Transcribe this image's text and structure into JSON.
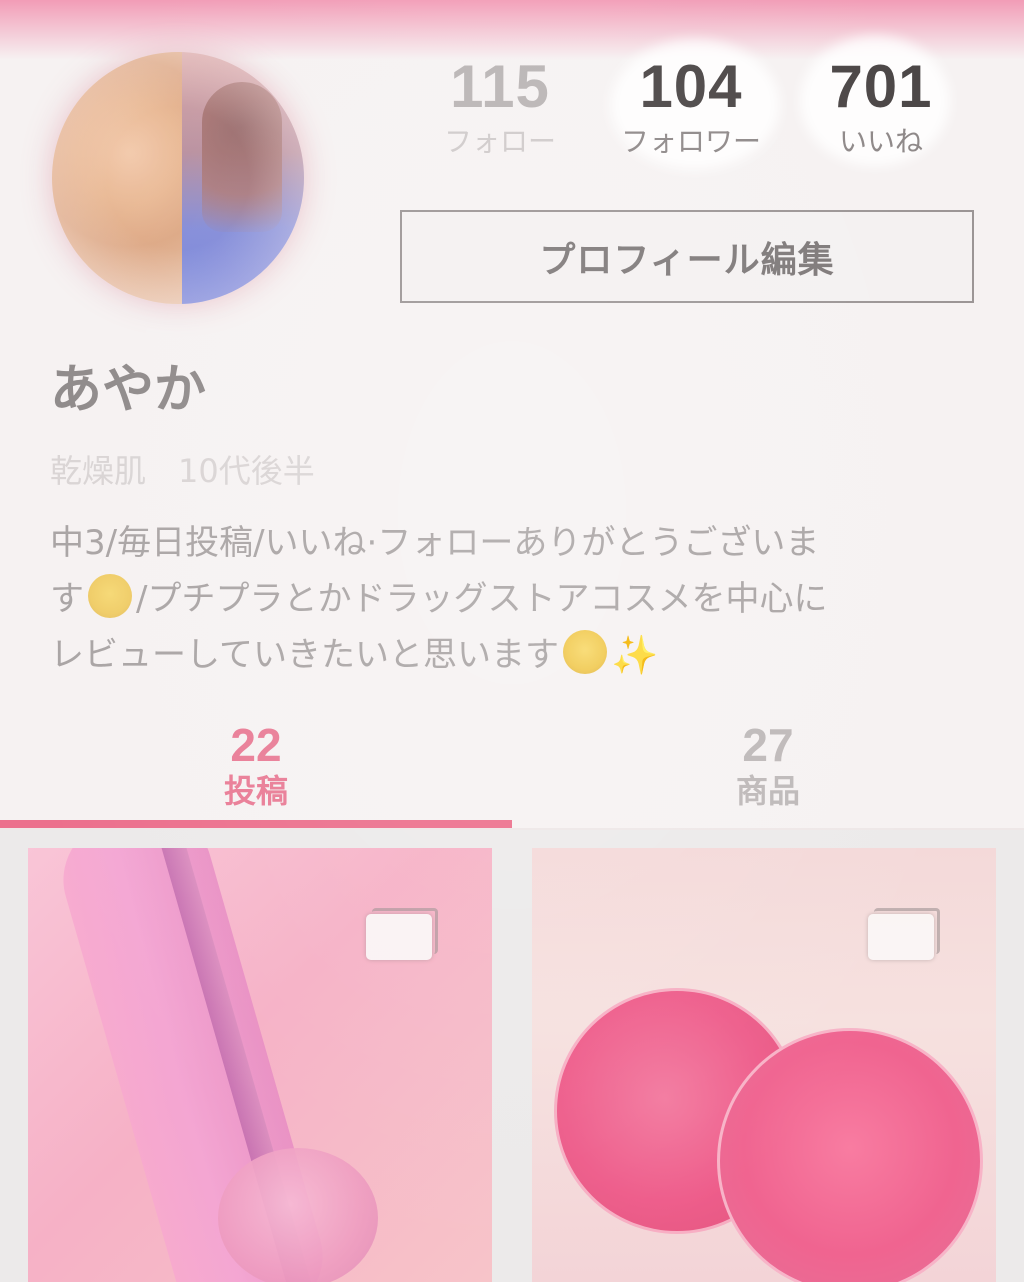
{
  "profile": {
    "stats": [
      {
        "count": "115",
        "label": "フォロー"
      },
      {
        "count": "104",
        "label": "フォロワー"
      },
      {
        "count": "701",
        "label": "いいね"
      }
    ],
    "edit_button_label": "プロフィール編集",
    "name": "あやか",
    "attributes": "乾燥肌　10代後半",
    "bio": {
      "line1": "中3/毎日投稿/いいね·フォローありがとうございま",
      "line2_prefix": "す",
      "line2_rest": "/プチプラとかドラッグストアコスメを中心に",
      "line3": "レビューしていきたいと思います",
      "sparkles": "✨"
    }
  },
  "tabs": [
    {
      "count": "22",
      "label": "投稿",
      "active": true
    },
    {
      "count": "27",
      "label": "商品",
      "active": false
    }
  ],
  "posts": [
    {
      "subject": "pink lip gloss tube",
      "icon": "multiple-images-icon"
    },
    {
      "subject": "pink lip balm pots",
      "icon": "multiple-images-icon"
    }
  ],
  "colors": {
    "accent": "#ec6f8c",
    "background": "#f6f2f2",
    "text_dark": "#4b4646",
    "text_muted": "#a9a4a4"
  }
}
